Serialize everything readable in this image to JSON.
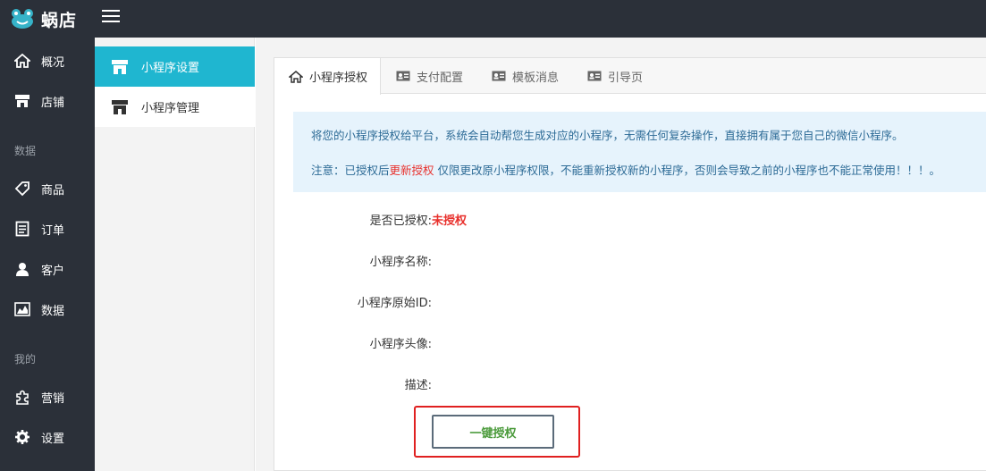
{
  "app": {
    "name": "蜗店"
  },
  "sidebar": {
    "items": [
      {
        "label": "概况",
        "icon": "home-icon"
      },
      {
        "label": "店铺",
        "icon": "store-icon"
      },
      {
        "label": "商品",
        "icon": "tag-icon"
      },
      {
        "label": "订单",
        "icon": "order-icon"
      },
      {
        "label": "客户",
        "icon": "user-icon"
      },
      {
        "label": "数据",
        "icon": "chart-icon"
      },
      {
        "label": "营销",
        "icon": "puzzle-icon"
      },
      {
        "label": "设置",
        "icon": "gear-icon"
      }
    ],
    "groups": {
      "data": "数据",
      "mine": "我的"
    }
  },
  "subnav": {
    "items": [
      {
        "label": "小程序设置",
        "icon": "store-icon",
        "active": true
      },
      {
        "label": "小程序管理",
        "icon": "store-icon",
        "active": false
      }
    ]
  },
  "tabs": [
    {
      "label": "小程序授权",
      "icon": "home-icon",
      "active": true
    },
    {
      "label": "支付配置",
      "icon": "id-card-icon"
    },
    {
      "label": "模板消息",
      "icon": "id-card-icon"
    },
    {
      "label": "引导页",
      "icon": "id-card-icon"
    }
  ],
  "notice": {
    "line1": "将您的小程序授权给平台，系统会自动帮您生成对应的小程序，无需任何复杂操作，直接拥有属于您自己的微信小程序。",
    "line2_prefix": "注意：已授权后",
    "line2_highlight": "更新授权",
    "line2_suffix": " 仅限更改原小程序权限，不能重新授权新的小程序，否则会导致之前的小程序也不能正常使用！！！。"
  },
  "form": {
    "authorized_label": "是否已授权:",
    "authorized_value": "未授权",
    "name_label": "小程序名称:",
    "original_id_label": "小程序原始ID:",
    "avatar_label": "小程序头像:",
    "description_label": "描述:"
  },
  "actions": {
    "authorize_button": "一键授权"
  },
  "colors": {
    "sidebar_bg": "#2b3039",
    "accent": "#1fb6d0",
    "notice_bg": "#e6f3fc",
    "notice_text": "#2d6b96",
    "danger": "#e8302c",
    "button_text": "#4a9a3a"
  }
}
